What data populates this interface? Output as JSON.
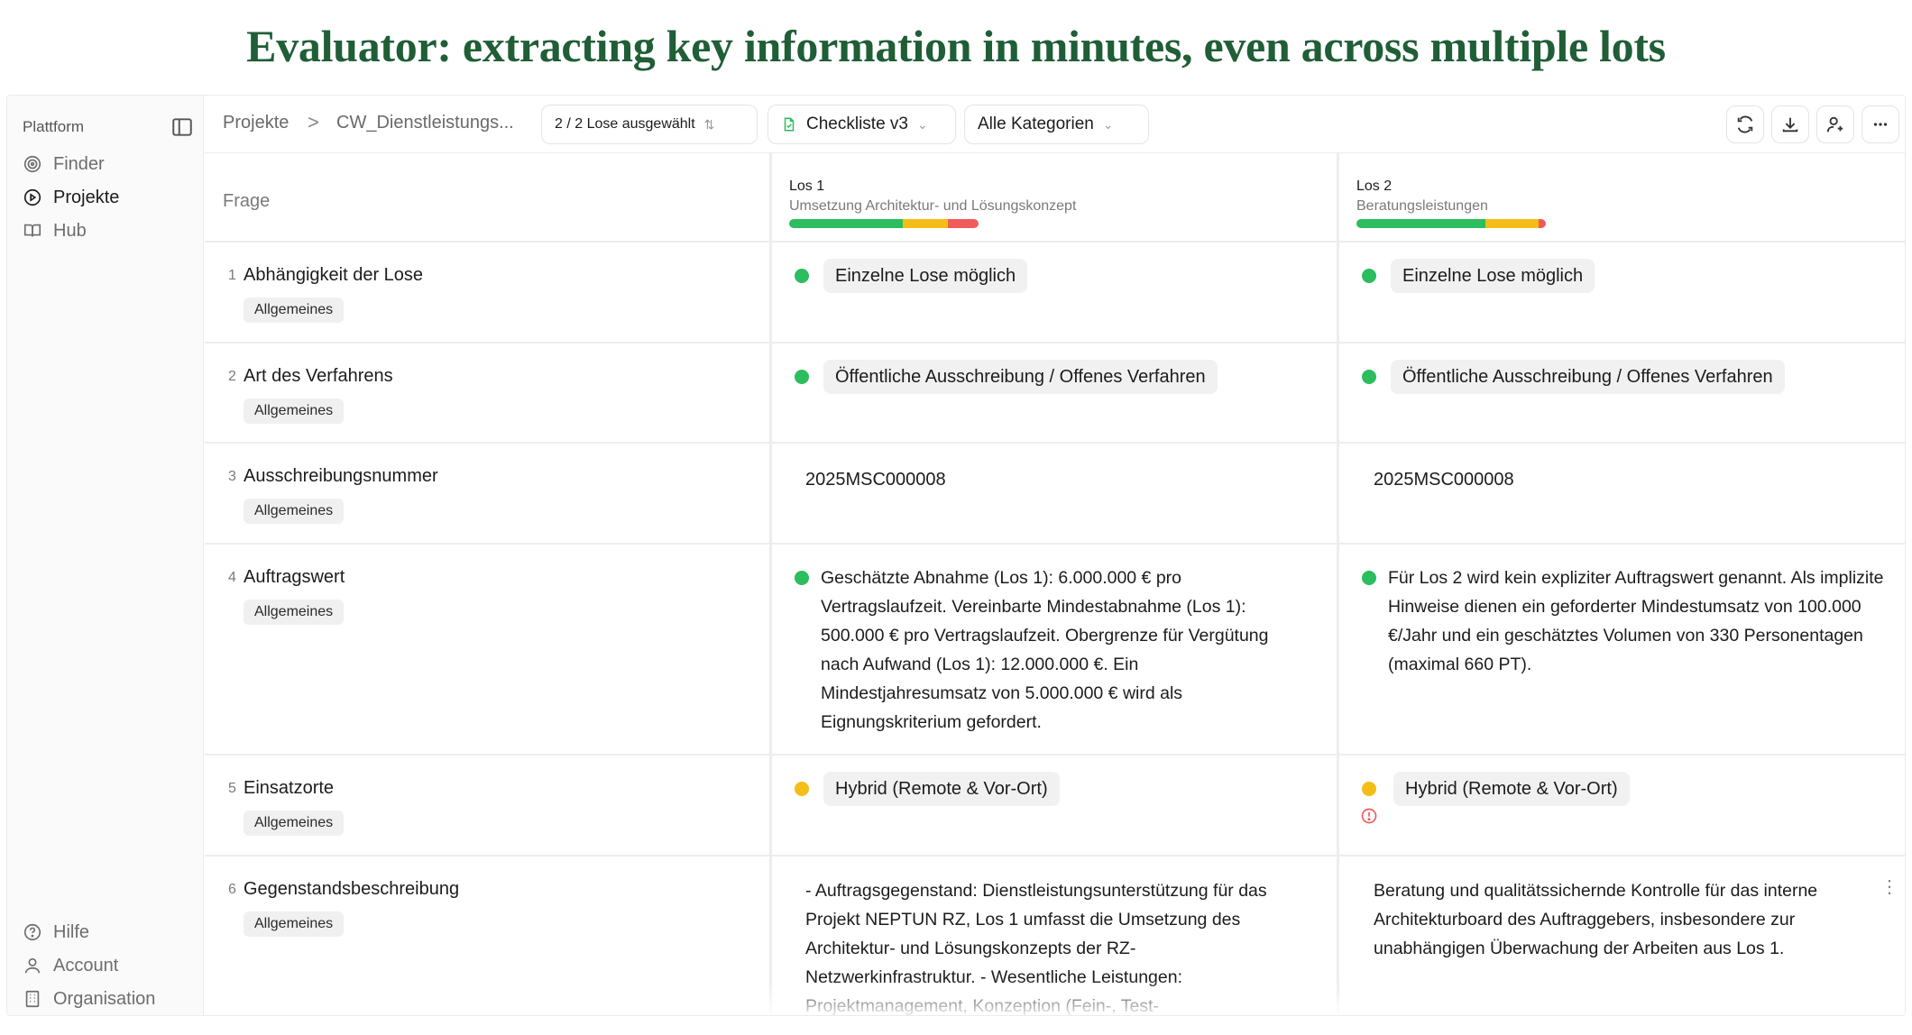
{
  "headline": "Evaluator: extracting key information in minutes, even across multiple lots",
  "sidebar": {
    "title": "Plattform",
    "items": [
      {
        "label": "Finder",
        "icon": "radar-icon"
      },
      {
        "label": "Projekte",
        "icon": "play-circle-icon",
        "active": true
      },
      {
        "label": "Hub",
        "icon": "book-icon"
      }
    ],
    "footer": [
      {
        "label": "Hilfe",
        "icon": "help-icon"
      },
      {
        "label": "Account",
        "icon": "user-icon"
      },
      {
        "label": "Organisation",
        "icon": "building-icon"
      }
    ]
  },
  "topbar": {
    "breadcrumb_root": "Projekte",
    "breadcrumb_sep": ">",
    "breadcrumb_project": "CW_Dienstleistungs...",
    "lot_selector": "2 / 2 Lose ausgewählt",
    "checklist": "Checkliste v3",
    "category": "Alle Kategorien"
  },
  "table": {
    "question_header": "Frage",
    "lots": [
      {
        "title": "Los 1",
        "subtitle": "Umsetzung Architektur- und Lösungskonzept",
        "status": {
          "green": 0.6,
          "yellow": 0.24,
          "red": 0.16
        }
      },
      {
        "title": "Los 2",
        "subtitle": "Beratungsleistungen",
        "status": {
          "green": 0.68,
          "yellow": 0.28,
          "red": 0.04
        }
      }
    ],
    "rows": [
      {
        "num": "1",
        "question": "Abhängigkeit der Lose",
        "category": "Allgemeines",
        "los1": "Einzelne Lose möglich",
        "los2": "Einzelne Lose möglich"
      },
      {
        "num": "2",
        "question": "Art des Verfahrens",
        "category": "Allgemeines",
        "los1": "Öffentliche Ausschreibung / Offenes Verfahren",
        "los2": "Öffentliche Ausschreibung / Offenes Verfahren"
      },
      {
        "num": "3",
        "question": "Ausschreibungsnummer",
        "category": "Allgemeines",
        "los1": "2025MSC000008",
        "los2": "2025MSC000008"
      },
      {
        "num": "4",
        "question": "Auftragswert",
        "category": "Allgemeines",
        "los1": "Geschätzte Abnahme (Los 1): 6.000.000 € pro Vertragslaufzeit. Vereinbarte Mindestabnahme (Los 1): 500.000 € pro Vertragslaufzeit. Obergrenze für Vergütung nach Aufwand (Los 1): 12.000.000 €. Ein Mindestjahresumsatz von 5.000.000 € wird als Eignungskriterium gefordert.",
        "los2": "Für Los 2 wird kein expliziter Auftragswert genannt. Als implizite Hinweise dienen ein geforderter Mindestumsatz von 100.000 €/Jahr und ein geschätztes Volumen von 330 Personentagen (maximal 660 PT)."
      },
      {
        "num": "5",
        "question": "Einsatzorte",
        "category": "Allgemeines",
        "los1": "Hybrid (Remote & Vor-Ort)",
        "los2": "Hybrid (Remote & Vor-Ort)"
      },
      {
        "num": "6",
        "question": "Gegenstandsbeschreibung",
        "category": "Allgemeines",
        "los1": "- Auftragsgegenstand: Dienstleistungsunterstützung für das Projekt NEPTUN RZ, Los 1 umfasst die Umsetzung des Architektur- und Lösungskonzepts der RZ-Netzwerkinfrastruktur. - Wesentliche Leistungen: Projektmanagement, Konzeption (Fein-, Test-",
        "los2": "Beratung und qualitätssichernde Kontrolle für das interne Architekturboard des Auftraggebers, insbesondere zur unabhängigen Überwachung der Arbeiten aus Los 1."
      }
    ]
  },
  "colors": {
    "green": "#2bbd5e",
    "yellow": "#f5bd17",
    "red": "#ef5b5b",
    "headline": "#1f5e36"
  }
}
